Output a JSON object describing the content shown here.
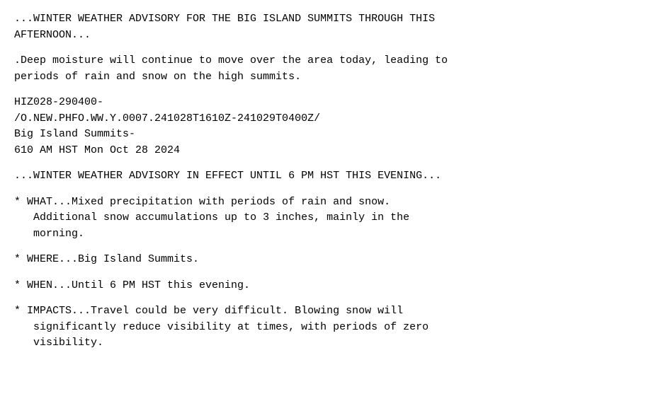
{
  "content": {
    "lines": [
      {
        "id": "headline1",
        "text": "...WINTER WEATHER ADVISORY FOR THE BIG ISLAND SUMMITS THROUGH THIS\nAFTERNOON..."
      },
      {
        "id": "blank1",
        "text": ""
      },
      {
        "id": "intro",
        "text": ".Deep moisture will continue to move over the area today, leading to\nperiods of rain and snow on the high summits."
      },
      {
        "id": "blank2",
        "text": ""
      },
      {
        "id": "meta",
        "text": "HIZ028-290400-\n/O.NEW.PHFO.WW.Y.0007.241028T1610Z-241029T0400Z/\nBig Island Summits-\n610 AM HST Mon Oct 28 2024"
      },
      {
        "id": "blank3",
        "text": ""
      },
      {
        "id": "headline2",
        "text": "...WINTER WEATHER ADVISORY IN EFFECT UNTIL 6 PM HST THIS EVENING..."
      },
      {
        "id": "blank4",
        "text": ""
      },
      {
        "id": "what",
        "text": "* WHAT...Mixed precipitation with periods of rain and snow.\n   Additional snow accumulations up to 3 inches, mainly in the\n   morning."
      },
      {
        "id": "blank5",
        "text": ""
      },
      {
        "id": "where",
        "text": "* WHERE...Big Island Summits."
      },
      {
        "id": "blank6",
        "text": ""
      },
      {
        "id": "when",
        "text": "* WHEN...Until 6 PM HST this evening."
      },
      {
        "id": "blank7",
        "text": ""
      },
      {
        "id": "impacts",
        "text": "* IMPACTS...Travel could be very difficult. Blowing snow will\n   significantly reduce visibility at times, with periods of zero\n   visibility."
      }
    ]
  }
}
